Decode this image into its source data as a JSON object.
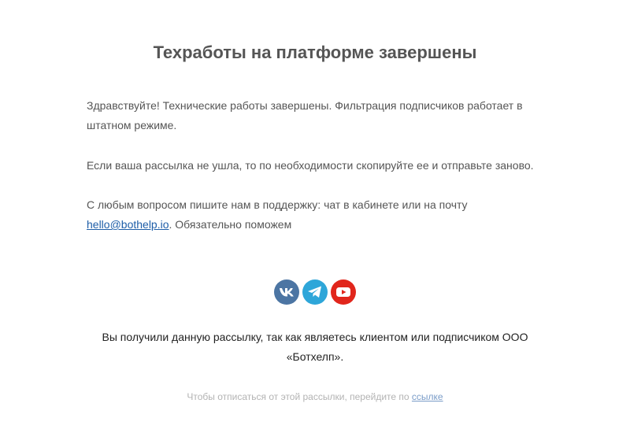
{
  "email": {
    "title": "Техработы на платформе завершены",
    "paragraph1": "Здравствуйте! Технические работы завершены. Фильтрация подписчиков работает в штатном режиме.",
    "paragraph2": "Если ваша рассылка не ушла, то по необходимости скопируйте ее и отправьте заново.",
    "paragraph3_before_link": "С любым вопросом пишите нам в поддержку: чат в кабинете или на почту ",
    "support_email": "hello@bothelp.io",
    "paragraph3_after_link": ". Обязательно поможем"
  },
  "socials": [
    {
      "icon": "vk-icon",
      "color": "#4c75a3"
    },
    {
      "icon": "telegram-icon",
      "color": "#2ea6d9"
    },
    {
      "icon": "youtube-icon",
      "color": "#e1261c"
    }
  ],
  "footer": {
    "notice": "Вы получили данную рассылку, так как являетесь клиентом или подписчиком ООО «Ботхелп».",
    "unsubscribe_text": "Чтобы отписаться от этой рассылки, перейдите по ",
    "unsubscribe_link": "ссылке"
  },
  "colors": {
    "link": "#1e5ea8",
    "text": "#555555"
  }
}
